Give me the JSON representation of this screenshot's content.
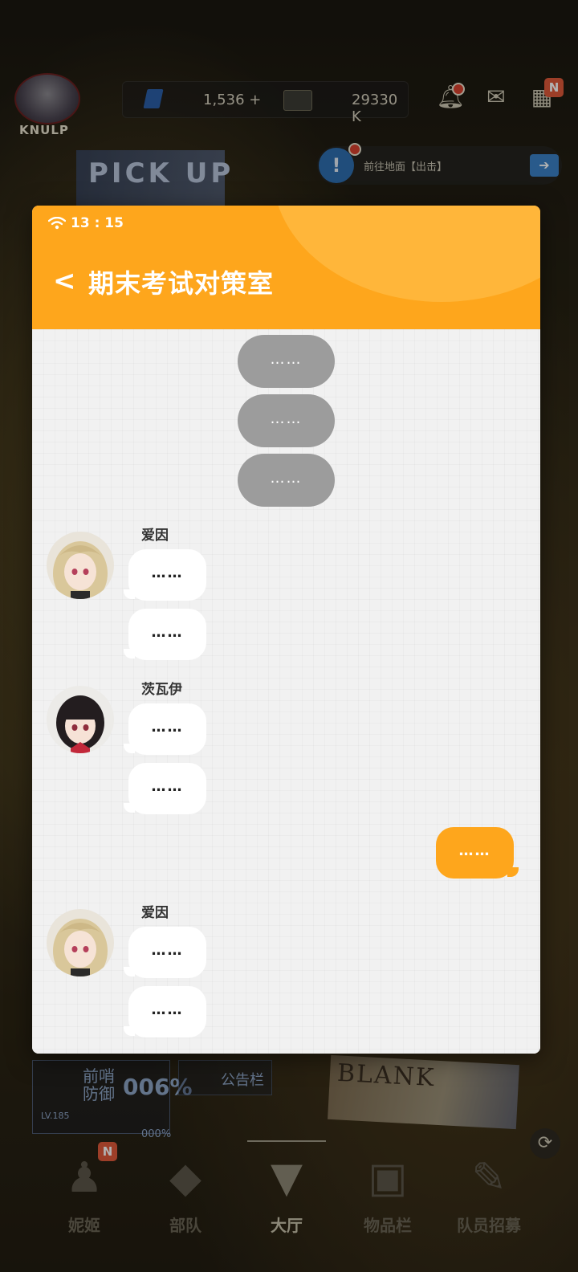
{
  "background": {
    "commander_name": "KNULP",
    "gem_value": "1,536",
    "gem_plus": "+",
    "credit_value": "29330 K",
    "n_badge": "N",
    "pickup_banner": "PICK UP",
    "quest_text": "前往地面【出击】",
    "defense_label": "前哨防御",
    "defense_value": "006%",
    "level_label": "LV.185",
    "level_percent": "000%",
    "notice_label": "公告栏",
    "ticket_text": "BLANK",
    "nav": [
      {
        "label": "妮姬",
        "badge": "N"
      },
      {
        "label": "部队"
      },
      {
        "label": "大厅"
      },
      {
        "label": "物品栏"
      },
      {
        "label": "队员招募"
      }
    ]
  },
  "phone": {
    "time": "13 : 15",
    "title": "期末考试对策室",
    "system_messages": [
      "……",
      "……",
      "……"
    ],
    "groups": [
      {
        "sender": "爱因",
        "messages": [
          "……",
          "……"
        ]
      },
      {
        "sender": "茨瓦伊",
        "messages": [
          "……",
          "……"
        ]
      },
      {
        "self": true,
        "messages": [
          "……"
        ]
      },
      {
        "sender": "爱因",
        "messages": [
          "……",
          "……"
        ]
      }
    ]
  },
  "colors": {
    "accent_orange": "#fea61c",
    "system_bubble_gray": "#9c9c9c",
    "chat_background": "#f1f1f1"
  }
}
